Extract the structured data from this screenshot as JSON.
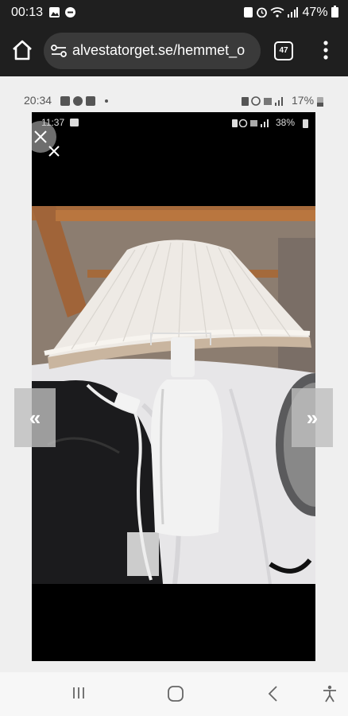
{
  "status_bar": {
    "time": "00:13",
    "battery": "47%"
  },
  "browser": {
    "url": "alvestatorget.se/hemmet_o",
    "tab_count": "47"
  },
  "inner_screenshot": {
    "status_time": "20:34",
    "status_battery": "17%",
    "photo_status_time": "11:37",
    "photo_status_battery": "38%"
  },
  "gallery": {
    "prev_label": "«",
    "next_label": "»"
  },
  "icons": [
    "home-icon",
    "site-settings-icon",
    "tabs-icon",
    "more-menu-icon",
    "close-icon",
    "recent-apps-icon",
    "home-nav-icon",
    "back-icon",
    "accessibility-icon"
  ]
}
